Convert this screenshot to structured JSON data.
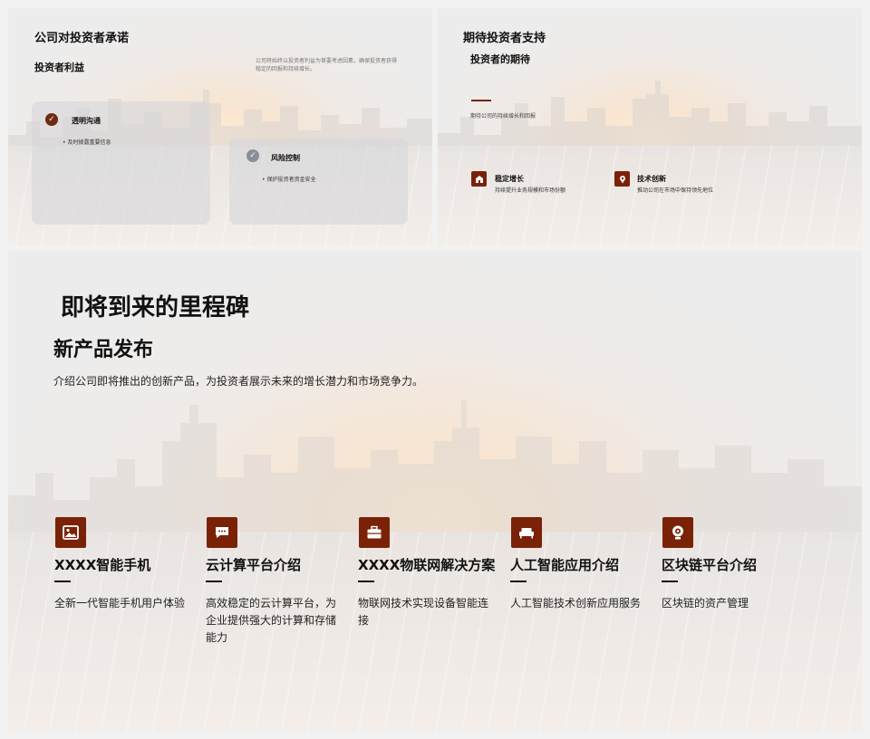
{
  "slide1": {
    "title": "公司对投资者承诺",
    "subtitle": "投资者利益",
    "description": "公司将始终以投资者利益为首要考虑因素，确保投资者获得稳定的回报和持续增长。",
    "cards": [
      {
        "title": "透明沟通",
        "bullet": "及时披露重要信息"
      },
      {
        "title": "风险控制",
        "bullet": "保护投资者资金安全"
      }
    ]
  },
  "slide2": {
    "title": "期待投资者支持",
    "subtitle": "投资者的期待",
    "description": "期待公司的持续增长和回报",
    "items": [
      {
        "icon": "building-icon",
        "title": "稳定增长",
        "desc": "持续提升业务规模和市场份额"
      },
      {
        "icon": "pin-icon",
        "title": "技术创新",
        "desc": "推动公司在市场中保持领先地位"
      }
    ]
  },
  "slide3": {
    "title": "即将到来的里程碑",
    "subtitle": "新产品发布",
    "intro": "介绍公司即将推出的创新产品，为投资者展示未来的增长潜力和市场竞争力。",
    "features": [
      {
        "icon": "image-icon",
        "title": "XXXX智能手机",
        "desc": "全新一代智能手机用户体验"
      },
      {
        "icon": "chat-icon",
        "title": "云计算平台介绍",
        "desc": "高效稳定的云计算平台，为企业提供强大的计算和存储能力"
      },
      {
        "icon": "briefcase-icon",
        "title": "XXXX物联网解决方案",
        "desc": "物联网技术实现设备智能连接"
      },
      {
        "icon": "sofa-icon",
        "title": "人工智能应用介绍",
        "desc": "人工智能技术创新应用服务"
      },
      {
        "icon": "webcam-icon",
        "title": "区块链平台介绍",
        "desc": "区块链的资产管理"
      }
    ]
  },
  "colors": {
    "accent": "#7a2208",
    "check_active": "#6e2a10",
    "check_inactive": "#8a8e99"
  }
}
